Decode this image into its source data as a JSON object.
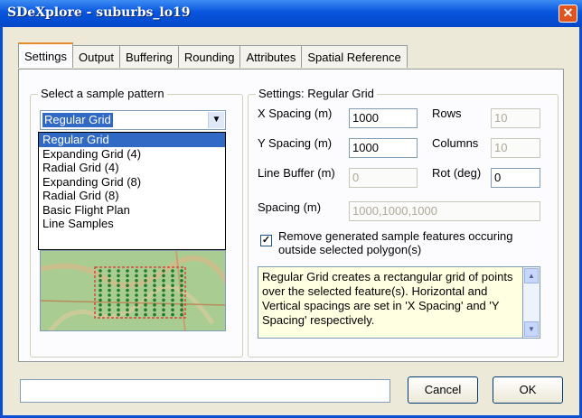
{
  "window": {
    "title": "SDeXplore - suburbs_lo19"
  },
  "tabs": [
    "Settings",
    "Output",
    "Buffering",
    "Rounding",
    "Attributes",
    "Spatial Reference"
  ],
  "sample_pattern": {
    "group_label": "Select a sample pattern",
    "selected": "Regular Grid",
    "options": [
      "Regular Grid",
      "Expanding Grid (4)",
      "Radial Grid (4)",
      "Expanding Grid (8)",
      "Radial Grid (8)",
      "Basic Flight Plan",
      "Line Samples"
    ]
  },
  "settings": {
    "group_label": "Settings: Regular Grid",
    "x_spacing_label": "X Spacing (m)",
    "x_spacing_value": "1000",
    "y_spacing_label": "Y Spacing (m)",
    "y_spacing_value": "1000",
    "line_buffer_label": "Line Buffer (m)",
    "line_buffer_value": "0",
    "spacing_label": "Spacing (m)",
    "spacing_value": "1000,1000,1000",
    "rows_label": "Rows",
    "rows_value": "10",
    "columns_label": "Columns",
    "columns_value": "10",
    "rot_label": "Rot (deg)",
    "rot_value": "0",
    "remove_features_label": "Remove generated sample features occuring outside selected polygon(s)",
    "remove_features_checked": true,
    "description": "Regular Grid creates a rectangular grid of points over the selected feature(s). Horizontal and Vertical spacings are set in 'X Spacing' and 'Y Spacing' respectively."
  },
  "buttons": {
    "cancel": "Cancel",
    "ok": "OK"
  },
  "colors": {
    "titlebar": "#0855dd",
    "selection": "#316ac5",
    "active_tab_accent": "#e68b2c",
    "map_points": "#1f7a2a"
  }
}
